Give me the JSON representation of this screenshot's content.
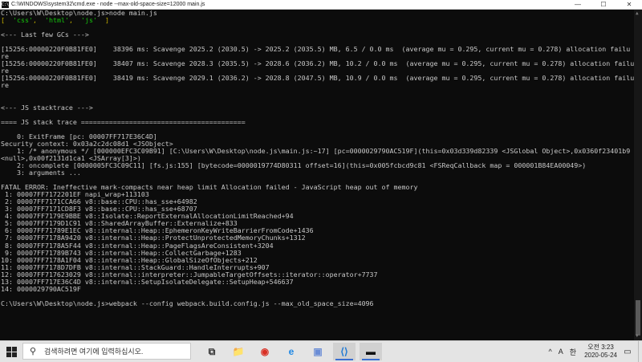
{
  "window": {
    "icon_text": "C:\\",
    "title": "C:\\WINDOWS\\system32\\cmd.exe - node  --max-old-space-size=12000 main.js",
    "controls": [
      "—",
      "☐",
      "✕"
    ]
  },
  "console": {
    "lines": [
      {
        "t": "C:\\Users\\W\\Desktop\\node.js>node main.js"
      },
      {
        "t": "[  'css',  'html',  'js'  ]",
        "style": "arrlist"
      },
      {
        "t": ""
      },
      {
        "t": "<--- Last few GCs --->"
      },
      {
        "t": ""
      },
      {
        "t": "[15256:00000220F0B81FE0]    38396 ms: Scavenge 2025.2 (2030.5) -> 2025.2 (2035.5) MB, 6.5 / 0.0 ms  (average mu = 0.295, current mu = 0.278) allocation failu"
      },
      {
        "t": "re"
      },
      {
        "t": "[15256:00000220F0B81FE0]    38407 ms: Scavenge 2028.3 (2035.5) -> 2028.6 (2036.2) MB, 10.2 / 0.0 ms  (average mu = 0.295, current mu = 0.278) allocation failu"
      },
      {
        "t": "re"
      },
      {
        "t": "[15256:00000220F0B81FE0]    38419 ms: Scavenge 2029.1 (2036.2) -> 2028.8 (2047.5) MB, 10.9 / 0.0 ms  (average mu = 0.295, current mu = 0.278) allocation failu"
      },
      {
        "t": "re"
      },
      {
        "t": ""
      },
      {
        "t": ""
      },
      {
        "t": "<--- JS stacktrace --->"
      },
      {
        "t": ""
      },
      {
        "t": "==== JS stack trace ========================================="
      },
      {
        "t": ""
      },
      {
        "t": "    0: ExitFrame [pc: 00007FF717E36C4D]"
      },
      {
        "t": "Security context: 0x03a2c2dc08d1 <JSObject>"
      },
      {
        "t": "    1: /* anonymous */ [000000EFC3C09B91] [C:\\Users\\W\\Desktop\\node.js\\main.js:~17] [pc=0000029790AC519F](this=0x03d339d82339 <JSGlobal Object>,0x0360f23401b9"
      },
      {
        "t": "<null>,0x00f2131d1ca1 <JSArray[3]>)"
      },
      {
        "t": "    2: oncomplete [0000005FC3C09C11] [fs.js:155] [bytecode=0000019774D80311 offset=16](this=0x005fcbcd9c81 <FSReqCallback map = 000001B84EA00049>)"
      },
      {
        "t": "    3: arguments ..."
      },
      {
        "t": ""
      },
      {
        "t": "FATAL ERROR: Ineffective mark-compacts near heap limit Allocation failed - JavaScript heap out of memory"
      },
      {
        "t": " 1: 00007FF7172201EF napi_wrap+113103"
      },
      {
        "t": " 2: 00007FF7171CCA66 v8::base::CPU::has_sse+64982"
      },
      {
        "t": " 3: 00007FF7171CD8F3 v8::base::CPU::has_sse+68707"
      },
      {
        "t": " 4: 00007FF7179E9BBE v8::Isolate::ReportExternalAllocationLimitReached+94"
      },
      {
        "t": " 5: 00007FF7179D1C91 v8::SharedArrayBuffer::Externalize+833"
      },
      {
        "t": " 6: 00007FF71789E1EC v8::internal::Heap::EphemeronKeyWriteBarrierFromCode+1436"
      },
      {
        "t": " 7: 00007FF7178A9420 v8::internal::Heap::ProtectUnprotectedMemoryChunks+1312"
      },
      {
        "t": " 8: 00007FF7178A5F44 v8::internal::Heap::PageFlagsAreConsistent+3204"
      },
      {
        "t": " 9: 00007FF71789B743 v8::internal::Heap::CollectGarbage+1283"
      },
      {
        "t": "10: 00007FF7178A1F04 v8::internal::Heap::GlobalSizeOfObjects+212"
      },
      {
        "t": "11: 00007FF7178D7DFB v8::internal::StackGuard::HandleInterrupts+907"
      },
      {
        "t": "12: 00007FF717623029 v8::internal::interpreter::JumpableTargetOffsets::iterator::operator+7737"
      },
      {
        "t": "13: 00007FF717E36C4D v8::internal::SetupIsolateDelegate::SetupHeap+546637"
      },
      {
        "t": "14: 0000029790AC519F"
      },
      {
        "t": ""
      },
      {
        "t": "C:\\Users\\W\\Desktop\\node.js>webpack --config webpack.build.config.js --max_old_space_size=4096"
      }
    ]
  },
  "taskbar": {
    "search_placeholder": "검색하려면 여기에 입력하십시오.",
    "apps": [
      {
        "name": "task-view-icon",
        "glyph": "⧉"
      },
      {
        "name": "file-explorer-icon",
        "glyph": "📁"
      },
      {
        "name": "chrome-icon",
        "glyph": "◉"
      },
      {
        "name": "internet-explorer-icon",
        "glyph": "e"
      },
      {
        "name": "app-icon",
        "glyph": "▣"
      },
      {
        "name": "vscode-icon",
        "glyph": "⟨⟩"
      },
      {
        "name": "cmd-icon",
        "glyph": "▬"
      }
    ],
    "tray": {
      "chevron": "^",
      "ime_mode": "A",
      "ime_lang": "한",
      "time": "오전 3:23",
      "date": "2020-05-24"
    }
  },
  "colors": {
    "console_bg": "#0c0c0c",
    "console_fg": "#c8c8c8",
    "accent": "#3a6fd1"
  }
}
